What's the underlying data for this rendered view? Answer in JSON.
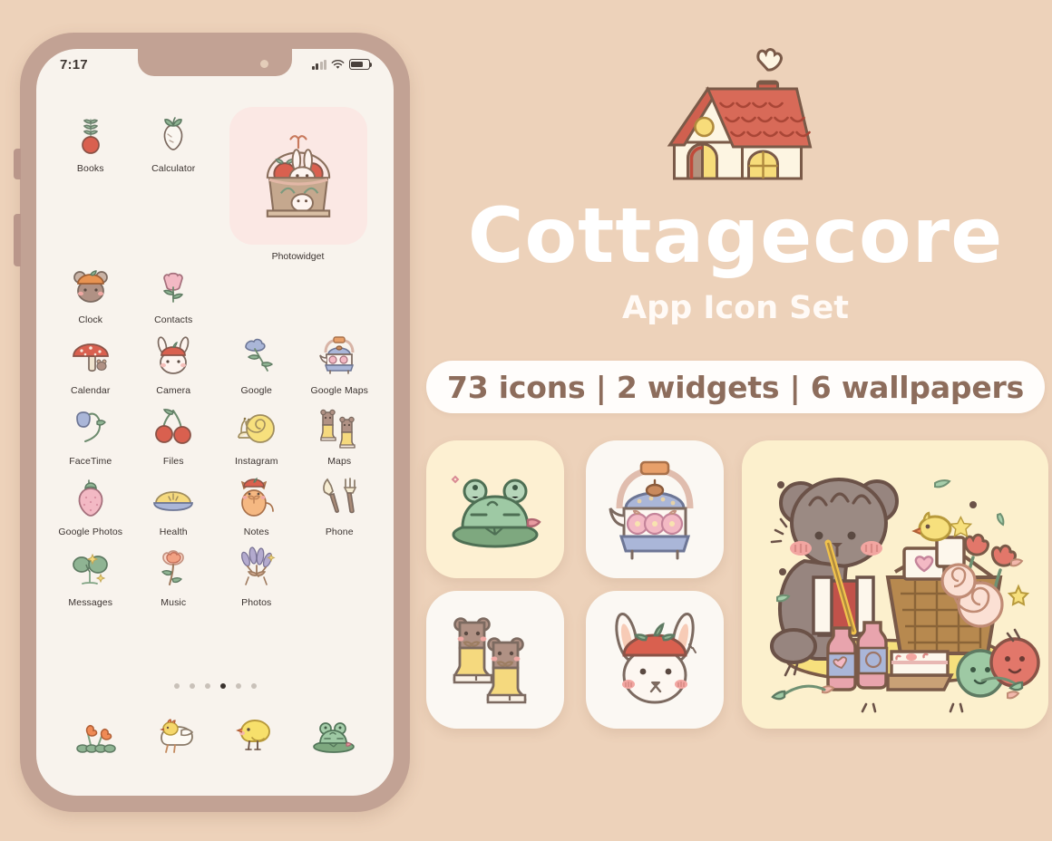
{
  "background_color": "#edd2ba",
  "phone": {
    "frame_color": "#c2a294",
    "screen_color": "#f8f3ed",
    "status_bar": {
      "time": "7:17",
      "signal_icon": "cellular-signal-icon",
      "wifi_icon": "wifi-icon",
      "battery_icon": "battery-icon"
    },
    "grid_rows": [
      {
        "type": "mixed",
        "apps": [
          {
            "label": "Books",
            "icon": "radish-icon"
          },
          {
            "label": "Calculator",
            "icon": "turnip-icon"
          }
        ],
        "widget": {
          "label": "Photowidget",
          "icon": "bunny-basket-widget",
          "tile_color": "#fbe8e4"
        }
      },
      {
        "type": "mixed-continued",
        "apps": [
          {
            "label": "Clock",
            "icon": "bear-pumpkin-hat-icon"
          },
          {
            "label": "Contacts",
            "icon": "pink-tulip-icon"
          }
        ]
      },
      {
        "type": "apps",
        "apps": [
          {
            "label": "Calendar",
            "icon": "mushroom-icon"
          },
          {
            "label": "Camera",
            "icon": "bunny-tomato-hat-icon"
          },
          {
            "label": "Google",
            "icon": "blue-bellflower-icon"
          },
          {
            "label": "Google Maps",
            "icon": "floral-teapot-icon"
          }
        ]
      },
      {
        "type": "apps",
        "apps": [
          {
            "label": "FaceTime",
            "icon": "bluebell-flower-icon"
          },
          {
            "label": "Files",
            "icon": "cherries-icon"
          },
          {
            "label": "Instagram",
            "icon": "snail-icon"
          },
          {
            "label": "Maps",
            "icon": "rain-boots-icon"
          }
        ]
      },
      {
        "type": "apps",
        "apps": [
          {
            "label": "Google Photos",
            "icon": "strawberry-icon"
          },
          {
            "label": "Health",
            "icon": "pie-icon"
          },
          {
            "label": "Notes",
            "icon": "orange-cat-icon"
          },
          {
            "label": "Phone",
            "icon": "garden-tools-icon"
          }
        ]
      },
      {
        "type": "apps",
        "apps": [
          {
            "label": "Messages",
            "icon": "clover-sprout-icon"
          },
          {
            "label": "Music",
            "icon": "peach-flower-icon"
          },
          {
            "label": "Photos",
            "icon": "lavender-bouquet-icon"
          }
        ]
      }
    ],
    "page_dots": {
      "count": 6,
      "active_index": 3
    },
    "dock": [
      {
        "icon": "orange-flowers-icon",
        "label": ""
      },
      {
        "icon": "hen-with-chick-icon",
        "label": ""
      },
      {
        "icon": "yellow-chick-icon",
        "label": ""
      },
      {
        "icon": "frog-on-lilypad-icon",
        "label": ""
      }
    ]
  },
  "promo": {
    "hero_icon": "cottage-house-icon",
    "title": "Cottagecore",
    "subtitle": "App Icon Set",
    "badge": "73 icons | 2 widgets | 6 wallpapers",
    "badge_text_color": "#8d6d5c",
    "title_color": "#ffffff",
    "showcase": [
      {
        "name": "frog-on-lilypad-tile",
        "icon": "frog-on-lilypad-icon",
        "tile_color": "#fdf0d2"
      },
      {
        "name": "floral-teapot-tile",
        "icon": "floral-teapot-icon",
        "tile_color": "#fbf8f3"
      },
      {
        "name": "rain-boots-tile",
        "icon": "rain-boots-icon",
        "tile_color": "#fbf8f3"
      },
      {
        "name": "bunny-tomato-hat-tile",
        "icon": "bunny-tomato-hat-icon",
        "tile_color": "#fbf8f3"
      },
      {
        "name": "picnic-bear-widget-tile",
        "icon": "picnic-bear-widget",
        "tile_color": "#fcf0cd"
      }
    ]
  }
}
